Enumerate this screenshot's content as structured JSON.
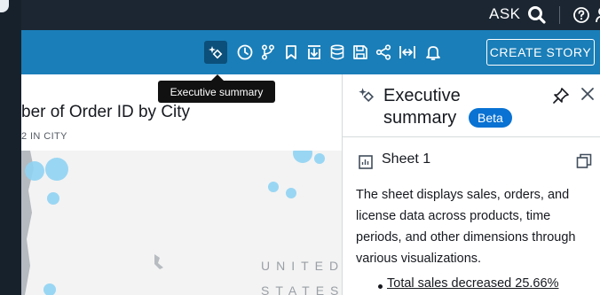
{
  "header": {
    "ask_label": "ASK"
  },
  "toolbar": {
    "icons": [
      "executive-summary-icon",
      "clock-icon",
      "branch-icon",
      "bookmark-icon",
      "export-icon",
      "database-icon",
      "save-icon",
      "share-icon",
      "fit-width-icon",
      "bell-icon"
    ],
    "create_story_label": "CREATE STORY"
  },
  "tooltip": {
    "text": "Executive summary"
  },
  "visual": {
    "title": "ber of Order ID by City",
    "subtitle": "2 IN CITY",
    "map_label_line1": "UNITED",
    "map_label_line2": "STATES"
  },
  "exec_panel": {
    "title_line1": "Executive",
    "title_line2": "summary",
    "badge": "Beta",
    "sheet_label": "Sheet 1",
    "summary": "The sheet displays sales, orders, and license data across products, time periods, and other dimensions through various visualizations.",
    "bullet": "Total sales decreased 25.66%"
  },
  "colors": {
    "toolbar_bg": "#1a7eb8",
    "topbar_bg": "#1b2632",
    "badge_bg": "#0972d3",
    "bubble": "#8fd3f3"
  }
}
